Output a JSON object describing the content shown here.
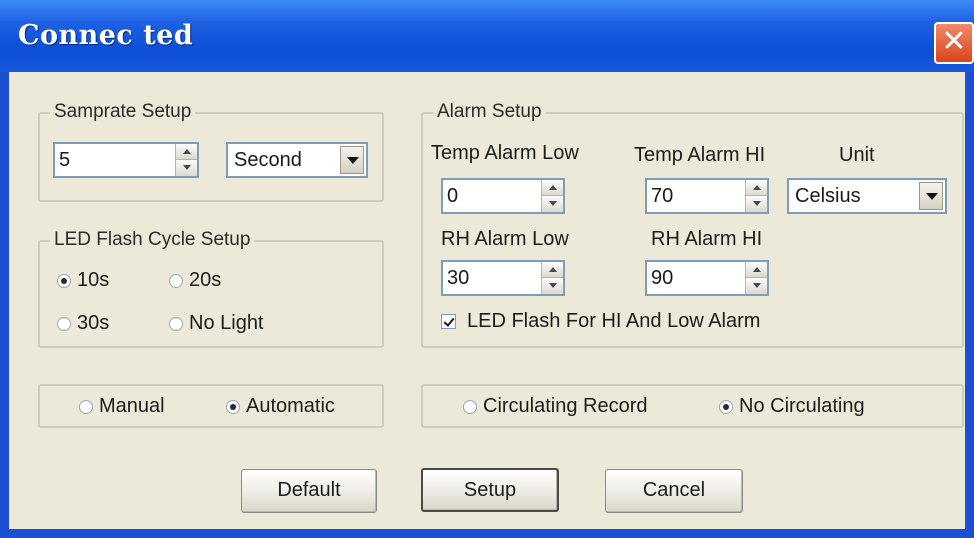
{
  "window": {
    "title": "Connec ted",
    "close_label": "✕"
  },
  "samprate": {
    "title": "Samprate Setup",
    "value": "5",
    "unit": "Second"
  },
  "led_cycle": {
    "title": "LED Flash Cycle Setup",
    "options": [
      "10s",
      "20s",
      "30s",
      "No Light"
    ],
    "selected": "10s"
  },
  "mode": {
    "options": [
      "Manual",
      "Automatic"
    ],
    "selected": "Automatic"
  },
  "alarm": {
    "title": "Alarm Setup",
    "temp_low_label": "Temp Alarm Low",
    "temp_low_value": "0",
    "temp_hi_label": "Temp Alarm HI",
    "temp_hi_value": "70",
    "unit_label": "Unit",
    "unit_value": "Celsius",
    "rh_low_label": "RH Alarm Low",
    "rh_low_value": "30",
    "rh_hi_label": "RH Alarm HI",
    "rh_hi_value": "90",
    "led_flash_label": "LED Flash For HI And Low  Alarm",
    "led_flash_checked": true
  },
  "record": {
    "options": [
      "Circulating Record",
      "No Circulating"
    ],
    "selected": "No Circulating"
  },
  "buttons": {
    "default": "Default",
    "setup": "Setup",
    "cancel": "Cancel"
  }
}
